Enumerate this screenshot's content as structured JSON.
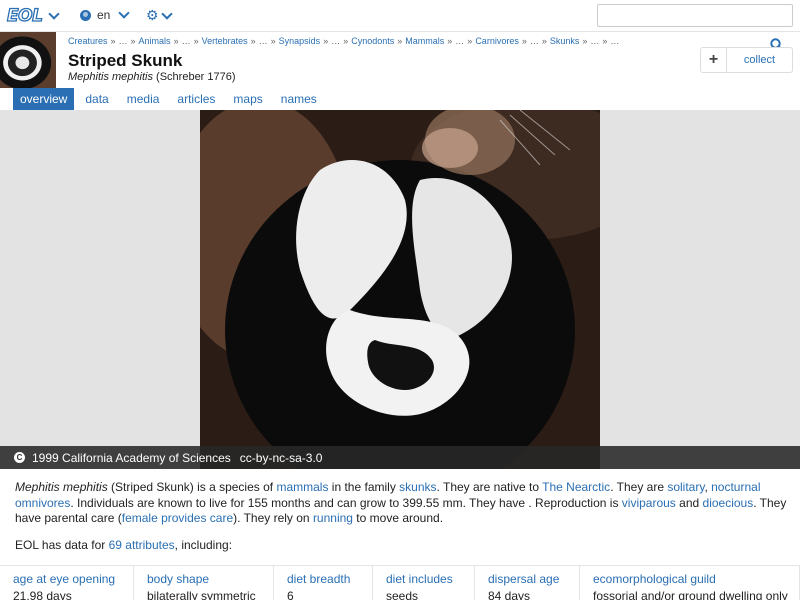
{
  "nav": {
    "logo": "EOL",
    "language": "en",
    "search_placeholder": ""
  },
  "header": {
    "breadcrumb": [
      "Creatures",
      "…",
      "Animals",
      "…",
      "Vertebrates",
      "…",
      "Synapsids",
      "…",
      "Cynodonts",
      "Mammals",
      "…",
      "Carnivores",
      "…",
      "Skunks",
      "…"
    ],
    "title": "Striped Skunk",
    "scientific_name": "Mephitis mephitis",
    "authority": "(Schreber 1776)",
    "collect_label": "collect",
    "collect_plus": "+"
  },
  "tabs": [
    {
      "label": "overview",
      "active": true
    },
    {
      "label": "data",
      "active": false
    },
    {
      "label": "media",
      "active": false
    },
    {
      "label": "articles",
      "active": false
    },
    {
      "label": "maps",
      "active": false
    },
    {
      "label": "names",
      "active": false
    }
  ],
  "media": {
    "credit": "1999 California Academy of Sciences",
    "license": "cc-by-nc-sa-3.0",
    "cc_icon": "C"
  },
  "description": {
    "sci": "Mephitis mephitis",
    "t1": " (Striped Skunk) is a species of ",
    "l1": "mammals",
    "t2": " in the family ",
    "l2": "skunks",
    "t3": ". They are native to ",
    "l3": "The Nearctic",
    "t4": ". They are ",
    "l4": "solitary",
    "t5": ", ",
    "l5": "nocturnal",
    "t6": " ",
    "l6": "omnivores",
    "t7": ". Individuals are known to live for 155 months and can grow to 399.55 mm. They have . Reproduction is ",
    "l7": "viviparous",
    "t8": " and ",
    "l8": "dioecious",
    "t9": ". They have parental care (",
    "l9": "female provides care",
    "t10": "). They rely on ",
    "l10": "running",
    "t11": " to move around."
  },
  "eol_data": {
    "prefix": "EOL has data for ",
    "link": "69 attributes",
    "suffix": ", including:"
  },
  "attributes": [
    {
      "key": "age at eye opening",
      "value": "21.98 days",
      "width": 134
    },
    {
      "key": "body shape",
      "value": "bilaterally symmetric",
      "width": 140
    },
    {
      "key": "diet breadth",
      "value": "6",
      "width": 99
    },
    {
      "key": "diet includes",
      "value": "seeds",
      "width": 102
    },
    {
      "key": "dispersal age",
      "value": "84 days",
      "width": 105
    },
    {
      "key": "ecomorphological guild",
      "value": "fossorial and/or ground dwelling only",
      "width": 220
    }
  ],
  "colors": {
    "accent": "#2a6fb3",
    "stage_bg": "#e3e3e3",
    "credit_bg": "#282828"
  }
}
